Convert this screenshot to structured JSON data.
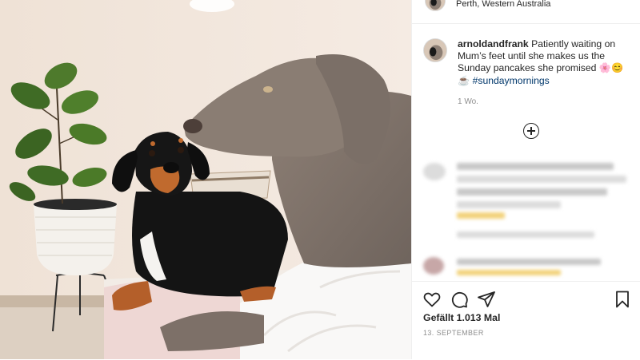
{
  "header": {
    "location": "Perth, Western Australia",
    "avatar_icon": "profile-avatar-icon"
  },
  "caption": {
    "username": "arnoldandfrank",
    "text": "Patiently waiting on Mum’s feet until she makes us the Sunday pancakes she promised",
    "emojis": "🌸😊☕",
    "hashtag": "#sundaymornings",
    "time": "1 Wo."
  },
  "comments": {
    "load_more_icon": "plus-circle-icon",
    "items": [
      "blurred-comment",
      "blurred-comment"
    ]
  },
  "actions": {
    "icons": [
      "heart-icon",
      "comment-icon",
      "share-icon",
      "bookmark-icon"
    ],
    "likes": "Gefällt 1.013 Mal",
    "date": "13. SEPTEMBER"
  },
  "colors": {
    "text": "#262626",
    "secondary": "#8e8e8e",
    "hashtag": "#00376b",
    "border": "#efefef"
  }
}
